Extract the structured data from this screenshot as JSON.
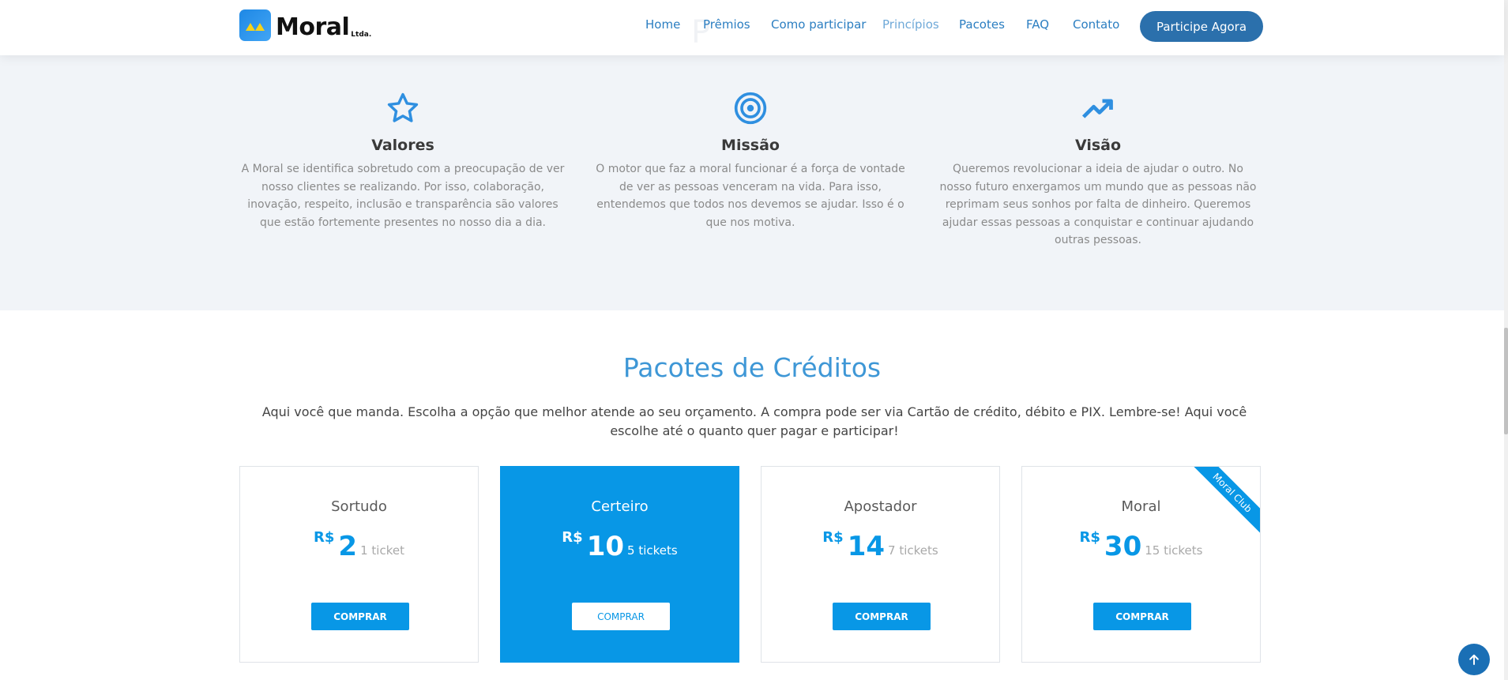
{
  "brand": {
    "name": "Moral",
    "suffix": "Ltda."
  },
  "nav": [
    {
      "label": "Home"
    },
    {
      "label": "Prêmios"
    },
    {
      "label": "Como participar"
    },
    {
      "label": "Princípios",
      "active": true
    },
    {
      "label": "Pacotes"
    },
    {
      "label": "FAQ"
    },
    {
      "label": "Contato"
    }
  ],
  "cta_label": "Participe Agora",
  "principles": [
    {
      "icon": "star-icon",
      "title": "Valores",
      "text": "A Moral se identifica sobretudo com a preocupação de ver nosso clientes se realizando. Por isso, colaboração, inovação, respeito, inclusão e transparência são valores que estão fortemente presentes no nosso dia a dia."
    },
    {
      "icon": "target-icon",
      "title": "Missão",
      "text": "O motor que faz a moral funcionar é a força de vontade de ver as pessoas venceram na vida. Para isso, entendemos que todos nos devemos se ajudar. Isso é o que nos motiva."
    },
    {
      "icon": "trending-up-icon",
      "title": "Visão",
      "text": "Queremos revolucionar a ideia de ajudar o outro. No nosso futuro enxergamos um mundo que as pessoas não reprimam seus sonhos por falta de dinheiro. Queremos ajudar essas pessoas a conquistar e continuar ajudando outras pessoas."
    }
  ],
  "packages": {
    "title": "Pacotes de Créditos",
    "description": "Aqui você que manda. Escolha a opção que melhor atende ao seu orçamento. A compra pode ser via Cartão de crédito, débito e PIX. Lembre-se! Aqui você escolhe até o quanto quer pagar e participar!",
    "items": [
      {
        "name": "Sortudo",
        "currency": "R$",
        "amount": "2",
        "tickets": "1 ticket",
        "button": "COMPRAR"
      },
      {
        "name": "Certeiro",
        "currency": "R$",
        "amount": "10",
        "tickets": "5 tickets",
        "button": "COMPRAR",
        "featured": true
      },
      {
        "name": "Apostador",
        "currency": "R$",
        "amount": "14",
        "tickets": "7 tickets",
        "button": "COMPRAR"
      },
      {
        "name": "Moral",
        "currency": "R$",
        "amount": "30",
        "tickets": "15 tickets",
        "button": "COMPRAR",
        "ribbon": "Moral Club"
      }
    ]
  },
  "colors": {
    "accent": "#0897e6",
    "nav": "#2b7ec1",
    "cta": "#2b70ac",
    "section_bg": "#f1f4f8"
  }
}
